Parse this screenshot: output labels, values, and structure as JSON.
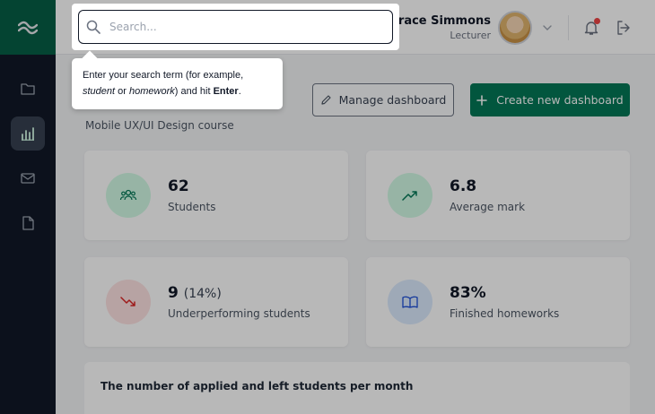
{
  "user": {
    "name": "Grace Simmons",
    "role": "Lecturer"
  },
  "search": {
    "placeholder": "Search..."
  },
  "tooltip": {
    "line1": "Enter your search term (for example,",
    "example1": "student",
    "or": " or ",
    "example2": "homework",
    "mid": ") and hit ",
    "key": "Enter",
    "end": "."
  },
  "toolbar": {
    "manage_label": "Manage dashboard",
    "create_label": "Create new dashboard"
  },
  "course": "Mobile UX/UI Design course",
  "stats": [
    {
      "value": "62",
      "label": "Students",
      "icon": "users-icon"
    },
    {
      "value": "6.8",
      "label": "Average mark",
      "icon": "trending-up-icon"
    },
    {
      "value": "9",
      "sub": "(14%)",
      "label": "Underperforming students",
      "icon": "trending-down-icon"
    },
    {
      "value": "83%",
      "label": "Finished homeworks",
      "icon": "book-icon"
    }
  ],
  "chart_panel": {
    "title": "The number of applied and left students per month"
  },
  "colors": {
    "brand": "#047857",
    "sidebar": "#111827",
    "notification": "#ef4444"
  },
  "sidebar": {
    "items": [
      "folder-icon",
      "bar-chart-icon",
      "mail-icon",
      "file-icon"
    ],
    "active": "bar-chart-icon"
  }
}
